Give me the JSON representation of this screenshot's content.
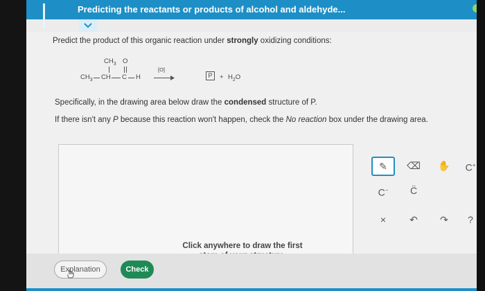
{
  "header": {
    "title": "Predicting the reactants or products of alcohol and aldehyde..."
  },
  "question": {
    "prompt_prefix": "Predict the product of this organic reaction under ",
    "prompt_bold": "strongly",
    "prompt_suffix": " oxidizing conditions:",
    "reaction": {
      "reactant_top_left": "CH",
      "reactant_top_left_sub": "3",
      "reactant_top_right": "O",
      "reactant_left": "CH",
      "reactant_left_sub": "3",
      "reactant_mid": "CH",
      "reactant_c": "C",
      "reactant_h": "H",
      "reagent": "[O]",
      "product_box": "P",
      "plus": "+",
      "water": "H",
      "water_sub": "2",
      "water_o": "O"
    },
    "spec_prefix": "Specifically, in the drawing area below draw the ",
    "spec_bold": "condensed",
    "spec_suffix": " structure of P.",
    "noreact_prefix": "If there isn't any ",
    "noreact_p": "P",
    "noreact_mid": " because this reaction won't happen, check the ",
    "noreact_italic": "No reaction",
    "noreact_suffix": " box under the drawing area."
  },
  "drawing": {
    "hint_line1": "Click anywhere to draw the first",
    "hint_line2": "atom of your structure."
  },
  "toolbar": {
    "pencil": "✎",
    "eraser": "⌫",
    "hand": "✋",
    "cplus": "C",
    "cplus_sup": "+",
    "cminus": "C",
    "cminus_sup": "−",
    "cdot": "C̈",
    "close": "×",
    "undo": "↶",
    "redo": "↷",
    "help": "?"
  },
  "buttons": {
    "explanation": "Explanation",
    "check": "Check"
  },
  "colors": {
    "topbar": "#1e8fc6",
    "check_button": "#1f8a55"
  },
  "icons": [
    "menu-icon",
    "chevron-down-icon",
    "pencil-icon",
    "eraser-icon",
    "hand-icon",
    "carbocation-icon",
    "carbanion-icon",
    "radical-icon",
    "close-icon",
    "undo-icon",
    "redo-icon",
    "help-icon",
    "hand-cursor-icon"
  ]
}
